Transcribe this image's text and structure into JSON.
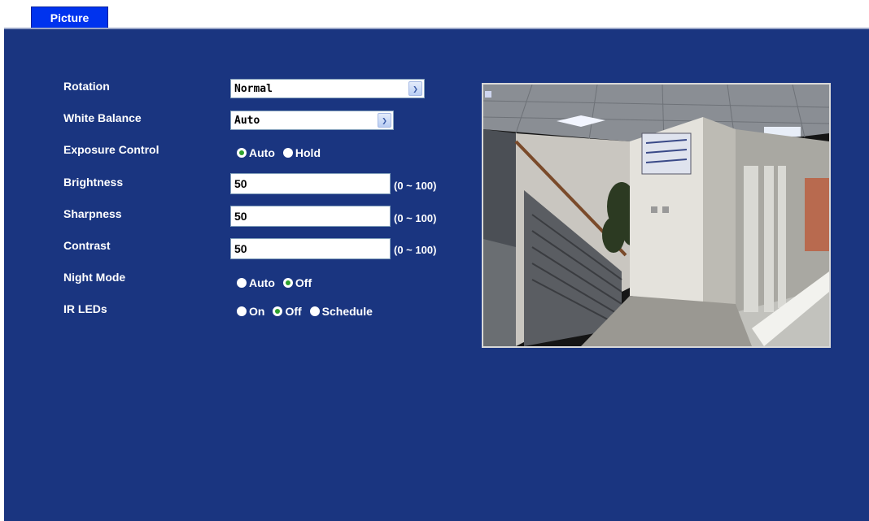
{
  "tab": {
    "label": "Picture"
  },
  "fields": {
    "rotation": {
      "label": "Rotation",
      "value": "Normal"
    },
    "white_balance": {
      "label": "White Balance",
      "value": "Auto"
    },
    "exposure_control": {
      "label": "Exposure Control",
      "options": [
        "Auto",
        "Hold"
      ],
      "selected": "Auto"
    },
    "brightness": {
      "label": "Brightness",
      "value": "50",
      "range": "(0 ~ 100)"
    },
    "sharpness": {
      "label": "Sharpness",
      "value": "50",
      "range": "(0 ~ 100)"
    },
    "contrast": {
      "label": "Contrast",
      "value": "50",
      "range": "(0 ~ 100)"
    },
    "night_mode": {
      "label": "Night Mode",
      "options": [
        "Auto",
        "Off"
      ],
      "selected": "Off"
    },
    "ir_leds": {
      "label": "IR LEDs",
      "options": [
        "On",
        "Off",
        "Schedule"
      ],
      "selected": "Off"
    }
  },
  "colors": {
    "panel_bg": "#1a3580",
    "tab_bg": "#0033ee",
    "radio_selected": "#2ea12e"
  },
  "icons": {
    "dropdown": "chevron-down-icon",
    "radio": "radio-button-icon"
  },
  "preview": {
    "type": "camera-live-view"
  }
}
